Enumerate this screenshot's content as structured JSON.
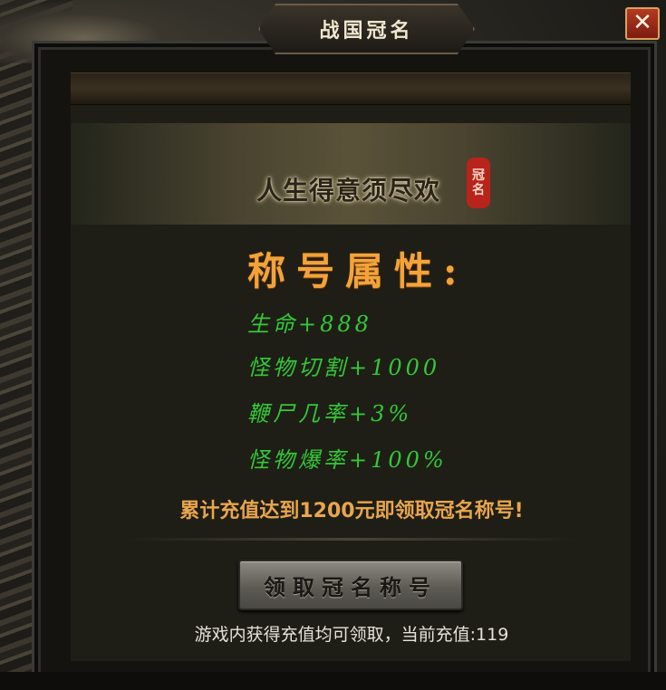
{
  "window": {
    "title": "战国冠名",
    "close_label": "✕"
  },
  "banner": {
    "slogan": "人生得意须尽欢",
    "seal_text": "冠名"
  },
  "attributes": {
    "heading": "称号属性:",
    "items": [
      "生命+888",
      "怪物切割+1000",
      "鞭尸几率+3%",
      "怪物爆率+100%"
    ]
  },
  "notice": "累计充值达到1200元即领取冠名称号!",
  "claim_button": {
    "label": "领取冠名称号"
  },
  "footer": {
    "text": "游戏内获得充值均可领取，当前充值:119"
  },
  "colors": {
    "heading": "#f2a43a",
    "attribute": "#39c43a",
    "notice": "#e9a64c",
    "close_button": "#b43a22"
  }
}
